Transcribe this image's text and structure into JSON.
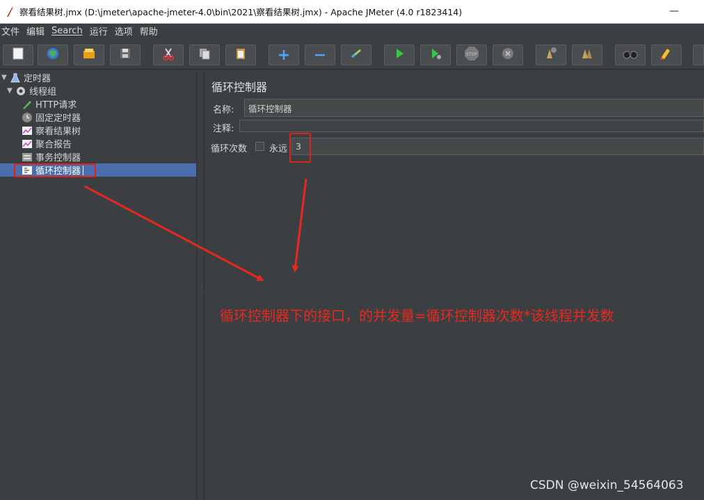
{
  "window": {
    "title": "察看结果树.jmx (D:\\jmeter\\apache-jmeter-4.0\\bin\\2021\\察看结果树.jmx) - Apache JMeter (4.0 r1823414)",
    "minimize_symbol": "—"
  },
  "menu": {
    "items": [
      "文件",
      "编辑",
      "Search",
      "运行",
      "选项",
      "帮助"
    ]
  },
  "toolbar": {
    "buttons": [
      {
        "icon": "new-icon"
      },
      {
        "icon": "templates-icon"
      },
      {
        "icon": "open-icon"
      },
      {
        "icon": "save-icon"
      },
      {
        "icon": "cut-icon"
      },
      {
        "icon": "copy-icon"
      },
      {
        "icon": "paste-icon"
      },
      {
        "icon": "expand-icon",
        "glyph": "+"
      },
      {
        "icon": "collapse-icon",
        "glyph": "−"
      },
      {
        "icon": "toggle-icon"
      },
      {
        "icon": "start-icon"
      },
      {
        "icon": "start-no-pause-icon"
      },
      {
        "icon": "stop-icon",
        "glyph": "STOP"
      },
      {
        "icon": "shutdown-icon"
      },
      {
        "icon": "clear-icon"
      },
      {
        "icon": "clear-all-icon"
      },
      {
        "icon": "search-icon"
      },
      {
        "icon": "reset-search-icon"
      }
    ]
  },
  "tree": {
    "nodes": [
      {
        "label": "定时器",
        "icon": "test-plan-icon"
      },
      {
        "label": "线程组",
        "icon": "thread-group-icon"
      },
      {
        "label": "HTTP请求",
        "icon": "sampler-icon"
      },
      {
        "label": "固定定时器",
        "icon": "timer-icon"
      },
      {
        "label": "察看结果树",
        "icon": "listener-icon"
      },
      {
        "label": "聚合报告",
        "icon": "listener-icon"
      },
      {
        "label": "事务控制器",
        "icon": "controller-icon"
      },
      {
        "label": "循环控制器",
        "icon": "loop-controller-icon"
      }
    ]
  },
  "panel": {
    "title": "循环控制器",
    "name_label": "名称:",
    "name_value": "循环控制器",
    "comment_label": "注释:",
    "comment_value": "",
    "loop_label": "循环次数",
    "forever_label": "永远",
    "loop_count": "3"
  },
  "annotation": {
    "text": "循环控制器下的接口，的并发量=循环控制器次数*该线程并发数",
    "color": "#e8281f"
  },
  "watermark": "CSDN @weixin_54564063"
}
